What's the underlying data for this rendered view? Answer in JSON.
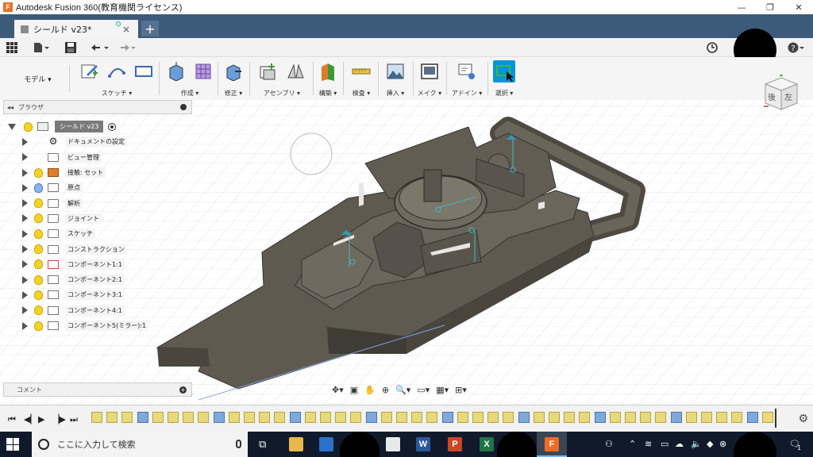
{
  "window": {
    "title": "Autodesk Fusion 360(教育機関ライセンス)",
    "logo_letter": "F",
    "minimize": "—",
    "restore": "❐",
    "close": "✕"
  },
  "tabs": {
    "active_label": "シールド v23*",
    "new_tab": "+",
    "close": "×"
  },
  "ribbon": {
    "workspace": "モデル ▾",
    "groups": [
      {
        "label": "スケッチ ▾"
      },
      {
        "label": "作成 ▾"
      },
      {
        "label": "修正 ▾"
      },
      {
        "label": "アセンブリ ▾"
      },
      {
        "label": "構築 ▾"
      },
      {
        "label": "検査 ▾"
      },
      {
        "label": "挿入 ▾"
      },
      {
        "label": "メイク ▾"
      },
      {
        "label": "アドイン ▾"
      },
      {
        "label": "選択 ▾"
      }
    ]
  },
  "browser": {
    "title": "ブラウザ",
    "root": "シールド v23",
    "items": [
      {
        "label": "ドキュメントの設定",
        "icon": "gear-icon"
      },
      {
        "label": "ビュー管理",
        "icon": "folder-icon"
      },
      {
        "label": "接触: セット",
        "icon": "contact-icon"
      },
      {
        "label": "原点",
        "icon": "folder-icon"
      },
      {
        "label": "解析",
        "icon": "folder-icon"
      },
      {
        "label": "ジョイント",
        "icon": "folder-icon"
      },
      {
        "label": "スケッチ",
        "icon": "folder-icon"
      },
      {
        "label": "コンストラクション",
        "icon": "folder-icon"
      },
      {
        "label": "コンポーネント1:1",
        "icon": "component-icon"
      },
      {
        "label": "コンポーネント2:1",
        "icon": "component-icon"
      },
      {
        "label": "コンポーネント3:1",
        "icon": "component-icon"
      },
      {
        "label": "コンポーネント4:1",
        "icon": "component-icon"
      },
      {
        "label": "コンポーネント5(ミラー):1",
        "icon": "component-icon"
      }
    ]
  },
  "comments": {
    "label": "コメント"
  },
  "viewcube": {
    "face_left": "後",
    "face_right": "左"
  },
  "taskbar": {
    "search_placeholder": "ここに入力して検索",
    "word": "W",
    "powerpoint": "P",
    "excel": "X",
    "fusion": "F",
    "notify_count": "1"
  },
  "colors": {
    "accent": "#0696d7",
    "tab_strip": "#3c5a7a",
    "model_body": "#5f5a50",
    "taskbar": "#101a2a"
  }
}
